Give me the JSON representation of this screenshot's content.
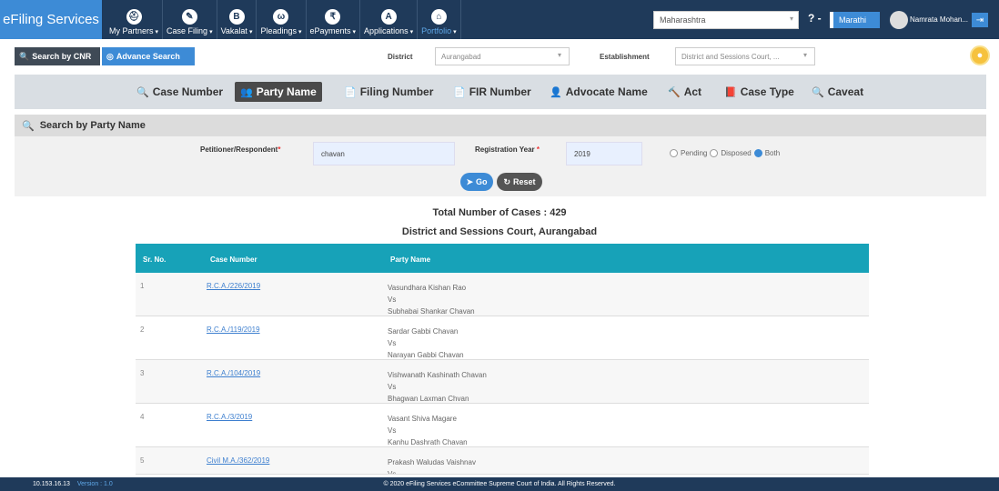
{
  "header": {
    "brand": "eFiling Services",
    "nav": [
      {
        "icon": "⛑",
        "label": "My Partners",
        "caret": "▾"
      },
      {
        "icon": "✎",
        "label": "Case Filing",
        "caret": "▾"
      },
      {
        "icon": "B",
        "label": "Vakalat",
        "caret": "▾"
      },
      {
        "icon": "ω",
        "label": "Pleadings",
        "caret": "▾"
      },
      {
        "icon": "₹",
        "label": "ePayments",
        "caret": "▾"
      },
      {
        "icon": "A",
        "label": "Applications",
        "caret": "▾"
      },
      {
        "icon": "⌂",
        "label": "Portfolio",
        "caret": "▾"
      }
    ],
    "state": "Maharashtra",
    "help": "? -",
    "language": "Marathi",
    "user": "Namrata Mohan..."
  },
  "search_modes": {
    "cnr": "Search by CNR",
    "advance": "Advance Search"
  },
  "filters": {
    "district_label": "District",
    "district_value": "Aurangabad",
    "establishment_label": "Establishment",
    "establishment_value": "District and Sessions Court, ..."
  },
  "tabs": [
    {
      "icon": "🔍",
      "label": "Case Number"
    },
    {
      "icon": "👥",
      "label": "Party Name"
    },
    {
      "icon": "📄",
      "label": "Filing Number"
    },
    {
      "icon": "📄",
      "label": "FIR Number"
    },
    {
      "icon": "👤",
      "label": "Advocate Name"
    },
    {
      "icon": "🔨",
      "label": "Act"
    },
    {
      "icon": "📕",
      "label": "Case Type"
    },
    {
      "icon": "🔍",
      "label": "Caveat"
    }
  ],
  "form": {
    "heading": "Search by Party Name",
    "party_label": "Petitioner/Respondent",
    "party_value": "chavan",
    "year_label": "Registration Year",
    "year_value": "2019",
    "required_mark": "*",
    "radio_pending": "Pending",
    "radio_disposed": "Disposed",
    "radio_both": "Both",
    "go": "Go",
    "reset": "Reset"
  },
  "results": {
    "total": "Total Number of Cases : 429",
    "court": "District and Sessions Court, Aurangabad",
    "headers": {
      "sr": "Sr. No.",
      "case": "Case Number",
      "party": "Party Name"
    },
    "rows": [
      {
        "sr": "1",
        "case": "R.C.A./226/2019",
        "p1": "Vasundhara Kishan Rao",
        "vs": "Vs",
        "p2": "Subhabai Shankar Chavan"
      },
      {
        "sr": "2",
        "case": "R.C.A./119/2019",
        "p1": "Sardar Gabbi Chavan",
        "vs": "Vs",
        "p2": "Narayan Gabbi Chavan"
      },
      {
        "sr": "3",
        "case": "R.C.A./104/2019",
        "p1": "Vishwanath Kashinath Chavan",
        "vs": "Vs",
        "p2": "Bhagwan Laxman Chvan"
      },
      {
        "sr": "4",
        "case": "R.C.A./3/2019",
        "p1": "Vasant Shiva Magare",
        "vs": "Vs",
        "p2": "Kanhu Dashrath Chavan"
      },
      {
        "sr": "5",
        "case": "Civil M.A./362/2019",
        "p1": "Prakash Waludas Vaishnav",
        "vs": "Vs",
        "p2": ""
      }
    ]
  },
  "footer": {
    "ip": "10.153.16.13",
    "version": "Version : 1.0",
    "copyright": "© 2020 eFiling Services eCommittee Supreme Court of India. All Rights Reserved."
  }
}
